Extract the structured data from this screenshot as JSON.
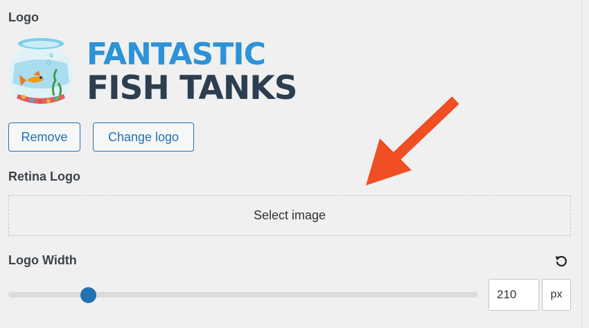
{
  "logo_section": {
    "title": "Logo",
    "logo": {
      "line1": "FANTASTIC",
      "line2": "FISH TANKS"
    },
    "buttons": {
      "remove": "Remove",
      "change": "Change logo"
    }
  },
  "retina_section": {
    "title": "Retina Logo",
    "select_label": "Select image"
  },
  "width_section": {
    "title": "Logo Width",
    "value": "210",
    "unit": "px",
    "slider_fraction": 0.17
  },
  "colors": {
    "accent": "#2271b1",
    "logo_blue": "#2d93d6",
    "logo_dark": "#2c3e50",
    "annotation_arrow": "#f04e23"
  },
  "icons": {
    "reset": "reset-icon",
    "fishbowl": "fishbowl-logo-icon",
    "annotation": "arrow-annotation-icon"
  }
}
